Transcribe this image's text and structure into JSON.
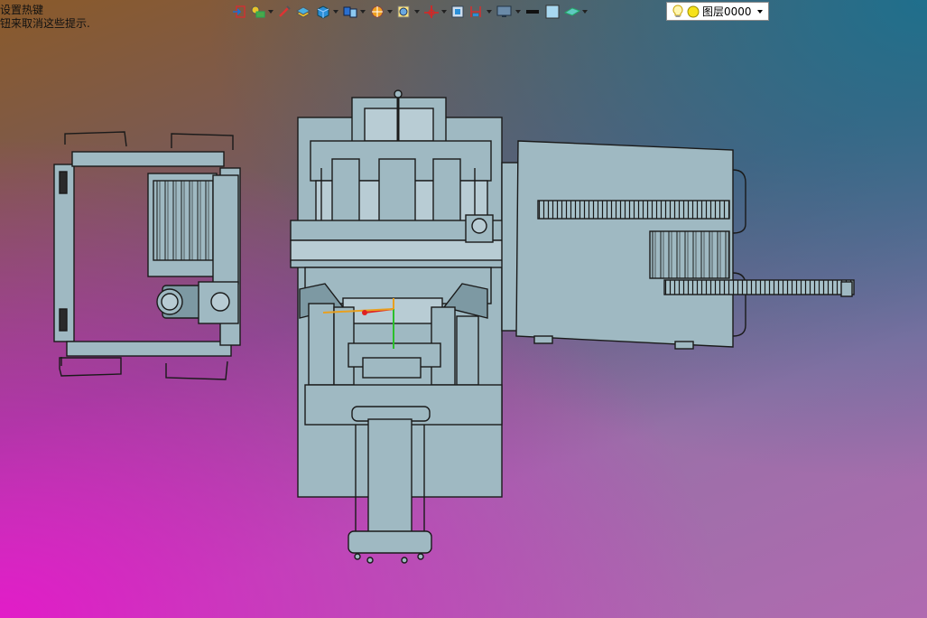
{
  "hint": {
    "line1": "设置热键",
    "line2": "钮来取消这些提示."
  },
  "toolbar": {
    "icons": [
      "exit-sketch-icon",
      "sketch-constraint-icon",
      "smart-dimension-icon",
      "extrude-icon",
      "solid-box-icon",
      "view-orientation-icon",
      "display-style-icon",
      "section-view-icon",
      "origin-axis-icon",
      "view-cube-icon",
      "hide-show-icon",
      "monitor-icon",
      "line-color-icon",
      "fill-color-icon",
      "plane-icon"
    ],
    "layer": {
      "label": "图层0000",
      "bulb_icon": "lightbulb-icon",
      "color_icon": "yellow-circle-icon"
    }
  },
  "colors": {
    "part_fill": "#9fb9c2",
    "part_stroke": "#1a1a1a",
    "part_shade": "#7d99a3",
    "axis_red": "#e02020",
    "axis_green": "#2bbf2b",
    "axis_orange": "#e8a020"
  }
}
